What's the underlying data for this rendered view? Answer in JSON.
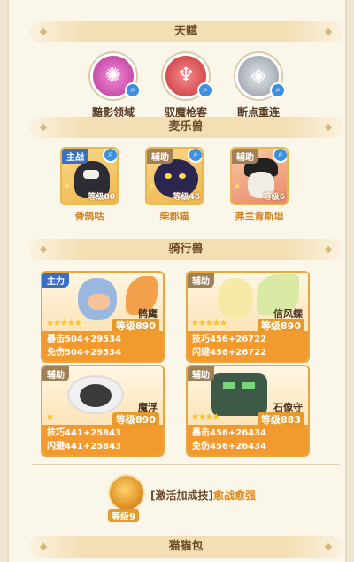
{
  "talent": {
    "title": "天赋",
    "items": [
      {
        "name": "黯影领域",
        "color": "#c94ca6",
        "icon": "shadow-domain-icon"
      },
      {
        "name": "驭魔枪客",
        "color": "#d9474b",
        "icon": "demon-lancer-icon"
      },
      {
        "name": "断点重连",
        "color": "#9aa3ad",
        "icon": "reconnect-icon"
      }
    ]
  },
  "pets": {
    "title": "麦乐兽",
    "items": [
      {
        "tag": "主战",
        "name": "骨鹄咕",
        "level": "等级80"
      },
      {
        "tag": "辅助",
        "name": "柴郡猫",
        "level": "等级46"
      },
      {
        "tag": "辅助",
        "name": "弗兰肯斯坦",
        "level": "等级6"
      }
    ]
  },
  "mounts": {
    "title": "骑行兽",
    "items": [
      {
        "tag": "主力",
        "name": "鹘鹰",
        "level": "等级890",
        "stat1": "暴击504+29534",
        "stat2": "免伤504+29534"
      },
      {
        "tag": "辅助",
        "name": "信风蝶",
        "level": "等级890",
        "stat1": "技巧456+26722",
        "stat2": "闪避456+26722"
      },
      {
        "tag": "辅助",
        "name": "魔浮",
        "level": "等级890",
        "stat1": "技巧441+25843",
        "stat2": "闪避441+25843"
      },
      {
        "tag": "辅助",
        "name": "石像守",
        "level": "等级883",
        "stat1": "暴击456+26434",
        "stat2": "免伤456+26434"
      }
    ]
  },
  "skill": {
    "prefix": "[激活加成技]",
    "name": "愈战愈强",
    "level": "等级9"
  },
  "bag": {
    "title": "猫猫包"
  }
}
